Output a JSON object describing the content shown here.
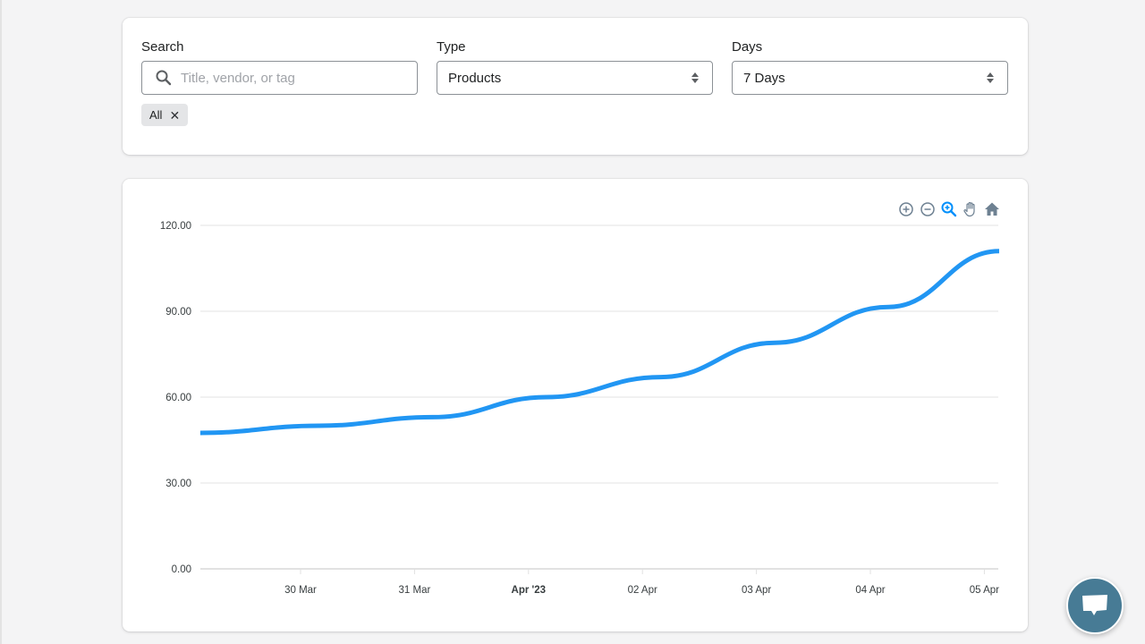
{
  "filters": {
    "search": {
      "label": "Search",
      "placeholder": "Title, vendor, or tag",
      "value": ""
    },
    "type": {
      "label": "Type",
      "selected": "Products"
    },
    "days": {
      "label": "Days",
      "selected": "7 Days"
    },
    "tags": [
      {
        "label": "All",
        "remove_icon": "close-icon"
      }
    ]
  },
  "toolbar": {
    "tools": [
      {
        "name": "zoom-in",
        "icon": "plus-circle-icon",
        "active": false
      },
      {
        "name": "zoom-out",
        "icon": "minus-circle-icon",
        "active": false
      },
      {
        "name": "selection-zoom",
        "icon": "magnifier-plus-icon",
        "active": true
      },
      {
        "name": "pan",
        "icon": "hand-icon",
        "active": false
      },
      {
        "name": "reset",
        "icon": "home-icon",
        "active": false
      }
    ],
    "active_color": "#008ffb",
    "inactive_color": "#6e8192"
  },
  "chat": {
    "icon": "chat-bubble-icon",
    "color": "#477b95"
  },
  "chart_data": {
    "type": "line",
    "title": "",
    "xlabel": "",
    "ylabel": "",
    "series": [
      {
        "name": "Products",
        "color": "#2196f3",
        "smooth": true,
        "points": [
          {
            "x": -0.88,
            "y": 47.5
          },
          {
            "x": 0.16,
            "y": 50
          },
          {
            "x": 1.16,
            "y": 53
          },
          {
            "x": 2.16,
            "y": 60
          },
          {
            "x": 3.16,
            "y": 67
          },
          {
            "x": 4.16,
            "y": 79
          },
          {
            "x": 5.16,
            "y": 91.5
          },
          {
            "x": 6.13,
            "y": 111
          }
        ]
      }
    ],
    "x_unit": "days since 30 Mar 2023",
    "xlim": [
      -0.88,
      6.13
    ],
    "ylim": [
      0,
      120
    ],
    "y_ticks": [
      {
        "value": 120,
        "label": "120.00"
      },
      {
        "value": 90,
        "label": "90.00"
      },
      {
        "value": 60,
        "label": "60.00"
      },
      {
        "value": 30,
        "label": "30.00"
      },
      {
        "value": 0,
        "label": "0.00"
      }
    ],
    "x_ticks": [
      {
        "value": 0,
        "label": "30 Mar",
        "bold": false
      },
      {
        "value": 1,
        "label": "31 Mar",
        "bold": false
      },
      {
        "value": 2,
        "label": "Apr '23",
        "bold": true
      },
      {
        "value": 3,
        "label": "02 Apr",
        "bold": false
      },
      {
        "value": 4,
        "label": "03 Apr",
        "bold": false
      },
      {
        "value": 5,
        "label": "04 Apr",
        "bold": false
      },
      {
        "value": 6,
        "label": "05 Apr",
        "bold": false
      }
    ],
    "grid": true,
    "legend": "none"
  }
}
